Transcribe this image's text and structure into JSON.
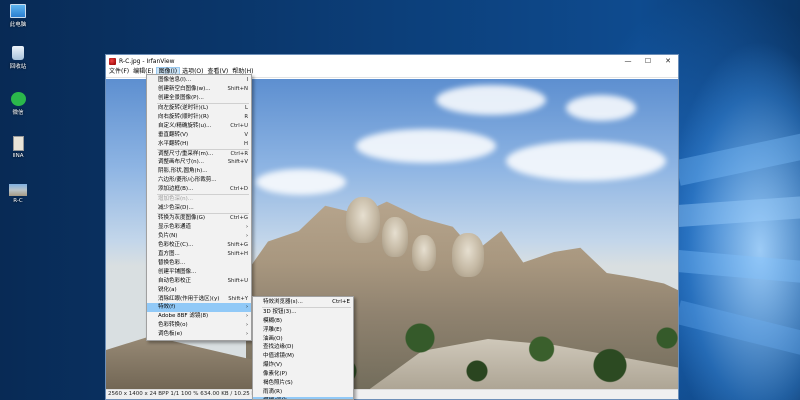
{
  "desktop": {
    "icons": [
      {
        "label": "此电脑",
        "icon": "computer-icon"
      },
      {
        "label": "回收站",
        "icon": "recycle-bin-icon"
      },
      {
        "label": "微信",
        "icon": "wechat-icon"
      },
      {
        "label": "IINA",
        "icon": "iina-icon"
      },
      {
        "label": "R-C",
        "icon": "image-file-icon"
      }
    ]
  },
  "window": {
    "title": "R-C.jpg - IrfanView",
    "buttons": {
      "minimize": "—",
      "maximize": "☐",
      "close": "✕"
    },
    "menu": [
      "文件(F)",
      "编辑(E)",
      "图像(I)",
      "选项(O)",
      "查看(V)",
      "帮助(H)"
    ],
    "status": "2560 x 1400 x 24 BPP    1/1    100 %    634.00 KB / 10.25 MB"
  },
  "image_menu": {
    "items": [
      {
        "label": "图像信息(I)...",
        "shortcut": "I"
      },
      {
        "label": "创建新空白图像(w)...",
        "shortcut": "Shift+N"
      },
      {
        "label": "创建全景图像(P)...",
        "shortcut": ""
      },
      {
        "sep": true
      },
      {
        "label": "向左旋转(逆时针)(L)",
        "shortcut": "L"
      },
      {
        "label": "向右旋转(顺时针)(R)",
        "shortcut": "R"
      },
      {
        "label": "自定义/精确旋转(u)...",
        "shortcut": "Ctrl+U"
      },
      {
        "label": "垂直翻转(V)",
        "shortcut": "V"
      },
      {
        "label": "水平翻转(H)",
        "shortcut": "H"
      },
      {
        "sep": true
      },
      {
        "label": "调整尺寸/重采样(m)...",
        "shortcut": "Ctrl+R"
      },
      {
        "label": "调整画布尺寸(n)...",
        "shortcut": "Shift+V"
      },
      {
        "label": "阴影,形状,圆角(h)...",
        "shortcut": ""
      },
      {
        "label": "六边形/菱形/心形裁剪...",
        "shortcut": ""
      },
      {
        "label": "添加边框(B)...",
        "shortcut": "Ctrl+D"
      },
      {
        "sep": true
      },
      {
        "label": "增加色深(n)...",
        "shortcut": "",
        "disabled": true
      },
      {
        "label": "减少色深(D)...",
        "shortcut": ""
      },
      {
        "sep": true
      },
      {
        "label": "转换为灰度图像(G)",
        "shortcut": "Ctrl+G"
      },
      {
        "label": "显示色彩通道",
        "shortcut": "",
        "submenu": true
      },
      {
        "label": "负片(N)",
        "shortcut": "",
        "submenu": true
      },
      {
        "label": "色彩校正(C)...",
        "shortcut": "Shift+G"
      },
      {
        "label": "直方图...",
        "shortcut": "Shift+H"
      },
      {
        "label": "替换色彩...",
        "shortcut": ""
      },
      {
        "label": "创建平铺图像...",
        "shortcut": ""
      },
      {
        "label": "自动色彩校正",
        "shortcut": "Shift+U"
      },
      {
        "label": "锐化(a)",
        "shortcut": ""
      },
      {
        "label": "消除红眼(作用于选区)(y)",
        "shortcut": "Shift+Y"
      },
      {
        "label": "特效(f)",
        "shortcut": "",
        "submenu": true,
        "hover": true
      },
      {
        "label": "Adobe 8BF 滤镜(8)",
        "shortcut": "",
        "submenu": true
      },
      {
        "label": "色彩转换(o)",
        "shortcut": "",
        "submenu": true
      },
      {
        "label": "调色板(e)",
        "shortcut": "",
        "submenu": true
      }
    ]
  },
  "effects_submenu": {
    "items": [
      {
        "label": "特效浏览器(s)...",
        "shortcut": "Ctrl+E"
      },
      {
        "sep": true
      },
      {
        "label": "3D 按钮(3)...",
        "shortcut": ""
      },
      {
        "label": "模糊(B)",
        "shortcut": ""
      },
      {
        "label": "浮雕(E)",
        "shortcut": ""
      },
      {
        "label": "油画(O)",
        "shortcut": ""
      },
      {
        "label": "查找边缘(D)",
        "shortcut": ""
      },
      {
        "label": "中值滤镜(M)",
        "shortcut": ""
      },
      {
        "label": "爆炸(V)",
        "shortcut": ""
      },
      {
        "label": "像素化(P)",
        "shortcut": ""
      },
      {
        "label": "褐色照片(S)",
        "shortcut": ""
      },
      {
        "label": "雨滴(R)",
        "shortcut": ""
      },
      {
        "label": "模糊/细化...",
        "shortcut": "",
        "hover": true
      }
    ]
  }
}
